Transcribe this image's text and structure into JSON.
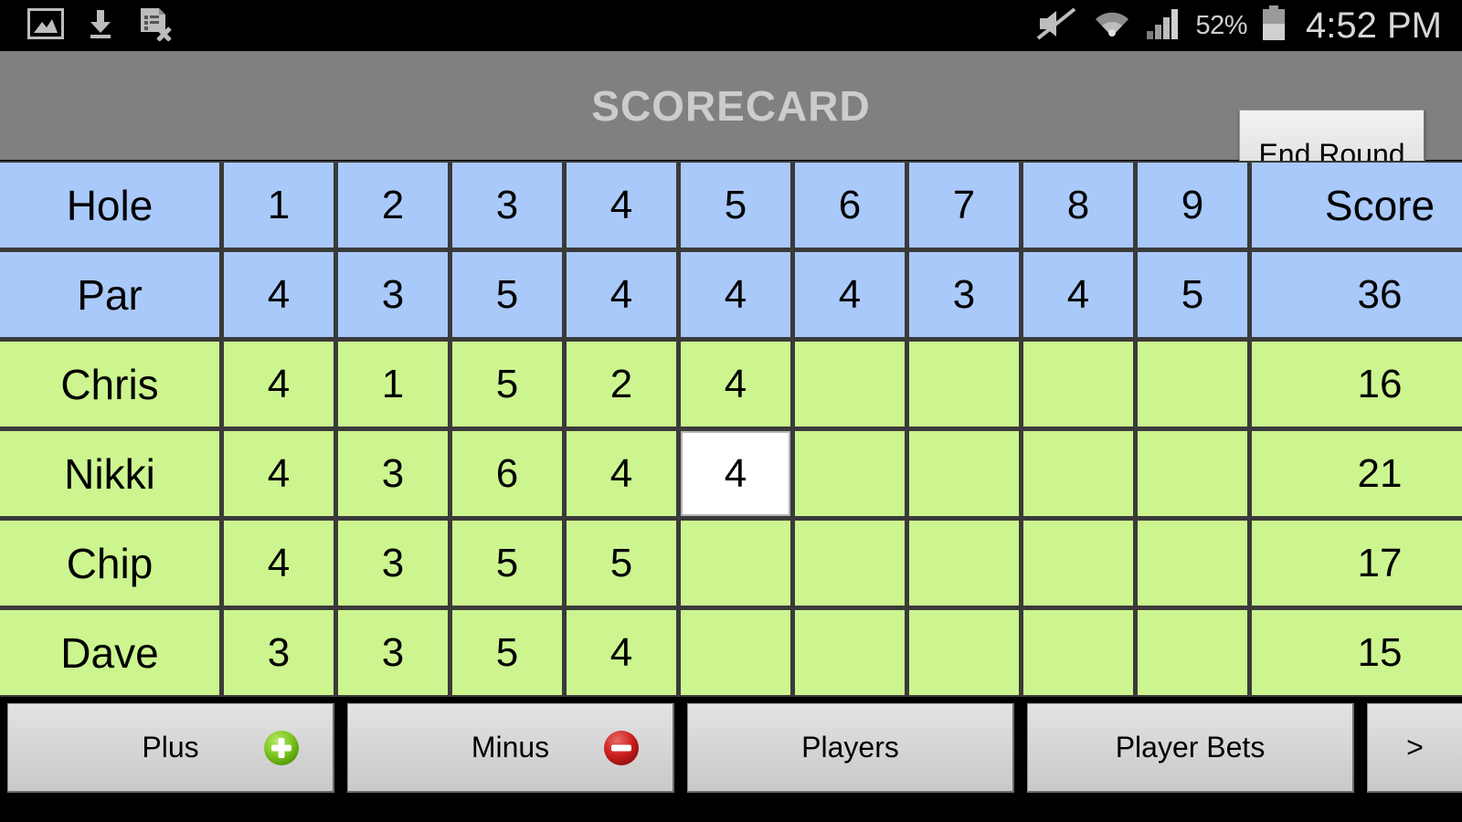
{
  "status_bar": {
    "left_icons": [
      "image-icon",
      "download-icon",
      "document-remove-icon"
    ],
    "right_icons": [
      "mute-icon",
      "wifi-icon",
      "cellular-signal-icon",
      "battery-icon"
    ],
    "battery_percent": "52%",
    "clock": "4:52 PM"
  },
  "title_bar": {
    "title": "SCORECARD",
    "end_round_label": "End Round",
    "background_color": "#808080",
    "title_color": "#cccccc"
  },
  "scorecard": {
    "header_row_label": "Hole",
    "par_row_label": "Par",
    "score_column_label": "Score",
    "holes": [
      "1",
      "2",
      "3",
      "4",
      "5",
      "6",
      "7",
      "8",
      "9"
    ],
    "par": [
      "4",
      "3",
      "5",
      "4",
      "4",
      "4",
      "3",
      "4",
      "5"
    ],
    "par_total": "36",
    "header_bg": "#a9c9fa",
    "player_bg": "#ccf58f",
    "selected_bg": "#ffffff",
    "selected_cell": {
      "player": "Nikki",
      "hole": "5",
      "value": "4"
    },
    "players": [
      {
        "name": "Chris",
        "scores": [
          "4",
          "1",
          "5",
          "2",
          "4",
          "",
          "",
          "",
          ""
        ],
        "total": "16"
      },
      {
        "name": "Nikki",
        "scores": [
          "4",
          "3",
          "6",
          "4",
          "4",
          "",
          "",
          "",
          ""
        ],
        "total": "21"
      },
      {
        "name": "Chip",
        "scores": [
          "4",
          "3",
          "5",
          "5",
          "",
          "",
          "",
          "",
          ""
        ],
        "total": "17"
      },
      {
        "name": "Dave",
        "scores": [
          "3",
          "3",
          "5",
          "4",
          "",
          "",
          "",
          "",
          ""
        ],
        "total": "15"
      }
    ]
  },
  "bottom_bar": {
    "buttons": [
      {
        "label": "Plus",
        "icon": "plus-circle-icon",
        "icon_color": "#7ac70c"
      },
      {
        "label": "Minus",
        "icon": "minus-circle-icon",
        "icon_color": "#d42c2c"
      },
      {
        "label": "Players",
        "icon": ""
      },
      {
        "label": "Player Bets",
        "icon": ""
      },
      {
        "label": ">",
        "icon": ""
      }
    ]
  }
}
